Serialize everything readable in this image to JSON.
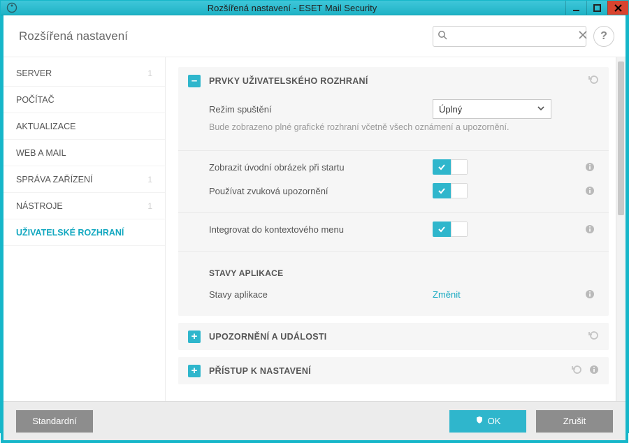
{
  "window": {
    "title": "Rozšířená nastavení - ESET Mail Security"
  },
  "toolbar": {
    "heading": "Rozšířená nastavení",
    "search_placeholder": ""
  },
  "sidebar": {
    "items": [
      {
        "label": "SERVER",
        "badge": "1"
      },
      {
        "label": "POČÍTAČ",
        "badge": ""
      },
      {
        "label": "AKTUALIZACE",
        "badge": ""
      },
      {
        "label": "WEB A MAIL",
        "badge": ""
      },
      {
        "label": "SPRÁVA ZAŘÍZENÍ",
        "badge": "1"
      },
      {
        "label": "NÁSTROJE",
        "badge": "1"
      },
      {
        "label": "UŽIVATELSKÉ ROZHRANÍ",
        "badge": ""
      }
    ],
    "active_index": 6
  },
  "sections": {
    "ui_elements": {
      "title": "PRVKY UŽIVATELSKÉHO ROZHRANÍ",
      "startup_mode_label": "Režim spuštění",
      "startup_mode_value": "Úplný",
      "startup_mode_desc": "Bude zobrazeno plné grafické rozhraní včetně všech oznámení a upozornění.",
      "show_splash_label": "Zobrazit úvodní obrázek při startu",
      "sound_alerts_label": "Používat zvuková upozornění",
      "context_menu_label": "Integrovat do kontextového menu",
      "app_states_heading": "STAVY APLIKACE",
      "app_states_label": "Stavy aplikace",
      "app_states_action": "Změnit"
    },
    "alerts": {
      "title": "UPOZORNĚNÍ A UDÁLOSTI"
    },
    "access": {
      "title": "PŘÍSTUP K NASTAVENÍ"
    }
  },
  "footer": {
    "default_label": "Standardní",
    "ok_label": "OK",
    "cancel_label": "Zrušit"
  },
  "glyphs": {
    "minus": "–",
    "plus": "+",
    "help": "?"
  }
}
